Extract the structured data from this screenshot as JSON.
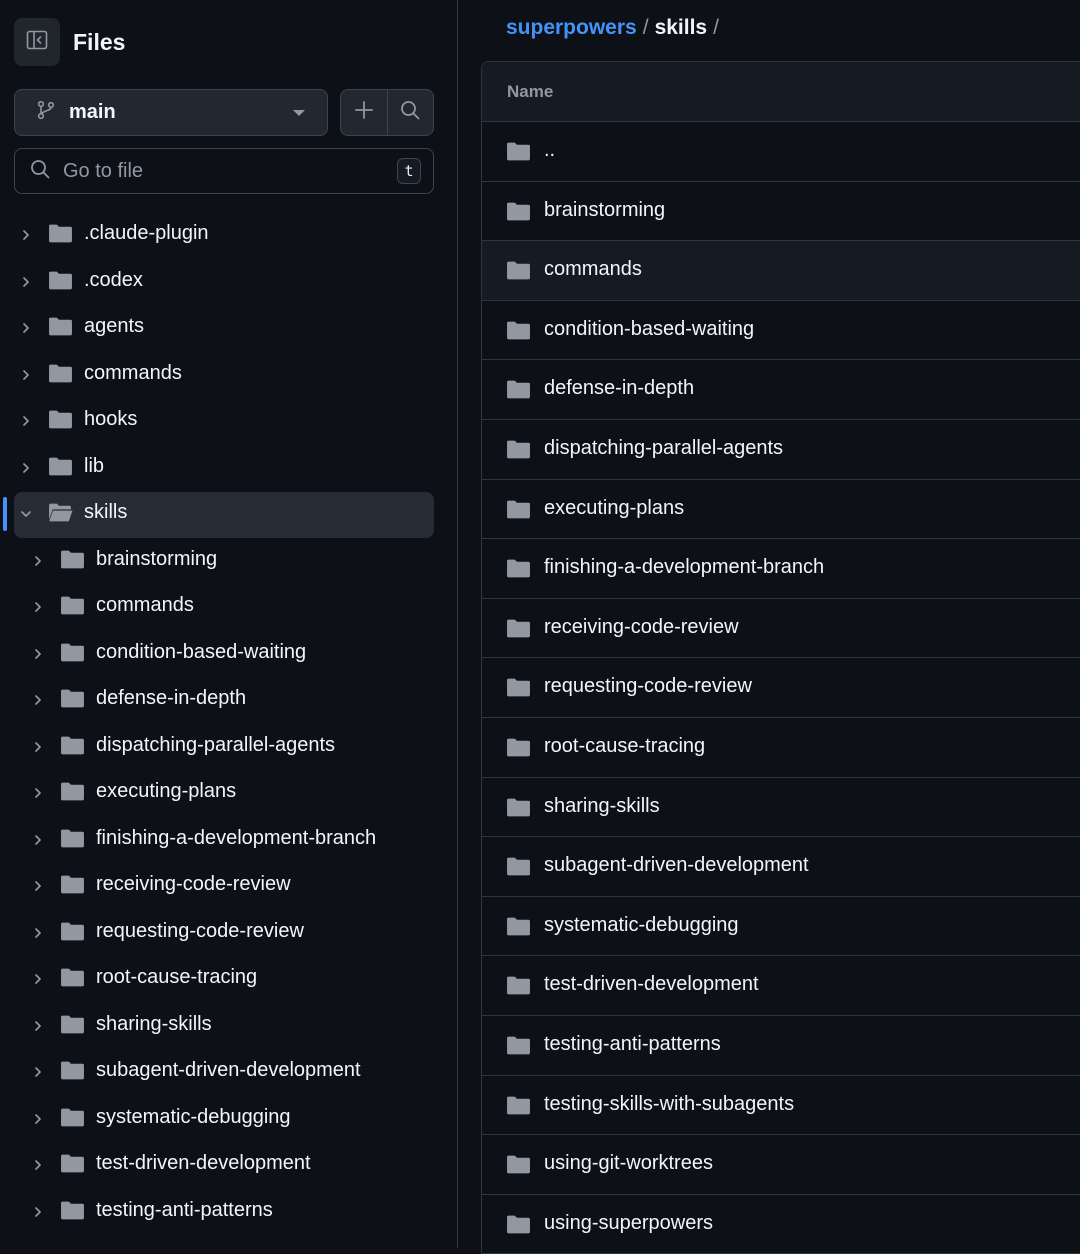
{
  "sidebar": {
    "title": "Files",
    "branch": "main",
    "goto_placeholder": "Go to file",
    "goto_shortcut": "t",
    "tree": [
      {
        "label": ".claude-plugin",
        "level": 0,
        "expanded": false
      },
      {
        "label": ".codex",
        "level": 0,
        "expanded": false
      },
      {
        "label": "agents",
        "level": 0,
        "expanded": false
      },
      {
        "label": "commands",
        "level": 0,
        "expanded": false
      },
      {
        "label": "hooks",
        "level": 0,
        "expanded": false
      },
      {
        "label": "lib",
        "level": 0,
        "expanded": false
      },
      {
        "label": "skills",
        "level": 0,
        "expanded": true,
        "selected": true
      },
      {
        "label": "brainstorming",
        "level": 1,
        "expanded": false
      },
      {
        "label": "commands",
        "level": 1,
        "expanded": false
      },
      {
        "label": "condition-based-waiting",
        "level": 1,
        "expanded": false
      },
      {
        "label": "defense-in-depth",
        "level": 1,
        "expanded": false
      },
      {
        "label": "dispatching-parallel-agents",
        "level": 1,
        "expanded": false
      },
      {
        "label": "executing-plans",
        "level": 1,
        "expanded": false
      },
      {
        "label": "finishing-a-development-branch",
        "level": 1,
        "expanded": false
      },
      {
        "label": "receiving-code-review",
        "level": 1,
        "expanded": false
      },
      {
        "label": "requesting-code-review",
        "level": 1,
        "expanded": false
      },
      {
        "label": "root-cause-tracing",
        "level": 1,
        "expanded": false
      },
      {
        "label": "sharing-skills",
        "level": 1,
        "expanded": false
      },
      {
        "label": "subagent-driven-development",
        "level": 1,
        "expanded": false
      },
      {
        "label": "systematic-debugging",
        "level": 1,
        "expanded": false
      },
      {
        "label": "test-driven-development",
        "level": 1,
        "expanded": false
      },
      {
        "label": "testing-anti-patterns",
        "level": 1,
        "expanded": false
      }
    ]
  },
  "breadcrumb": {
    "repo": "superpowers",
    "separator": "/",
    "current": "skills",
    "trailing": "/"
  },
  "table": {
    "header_name": "Name",
    "rows": [
      {
        "name": "..",
        "hover": false
      },
      {
        "name": "brainstorming",
        "hover": false
      },
      {
        "name": "commands",
        "hover": true
      },
      {
        "name": "condition-based-waiting",
        "hover": false
      },
      {
        "name": "defense-in-depth",
        "hover": false
      },
      {
        "name": "dispatching-parallel-agents",
        "hover": false
      },
      {
        "name": "executing-plans",
        "hover": false
      },
      {
        "name": "finishing-a-development-branch",
        "hover": false
      },
      {
        "name": "receiving-code-review",
        "hover": false
      },
      {
        "name": "requesting-code-review",
        "hover": false
      },
      {
        "name": "root-cause-tracing",
        "hover": false
      },
      {
        "name": "sharing-skills",
        "hover": false
      },
      {
        "name": "subagent-driven-development",
        "hover": false
      },
      {
        "name": "systematic-debugging",
        "hover": false
      },
      {
        "name": "test-driven-development",
        "hover": false
      },
      {
        "name": "testing-anti-patterns",
        "hover": false
      },
      {
        "name": "testing-skills-with-subagents",
        "hover": false
      },
      {
        "name": "using-git-worktrees",
        "hover": false
      },
      {
        "name": "using-superpowers",
        "hover": false
      }
    ]
  },
  "colors": {
    "background": "#0d1117",
    "link": "#4493f8",
    "folder": "#9198a1",
    "selected_bg": "#262c36",
    "border": "#30363d"
  },
  "icons": {
    "panel_toggle": "sidebar-collapse-icon",
    "branch": "git-branch-icon",
    "add": "plus-icon",
    "search": "search-icon",
    "folder": "folder-icon",
    "folder_open": "folder-open-icon",
    "chevron_right": "chevron-right-icon",
    "chevron_down": "chevron-down-icon"
  }
}
